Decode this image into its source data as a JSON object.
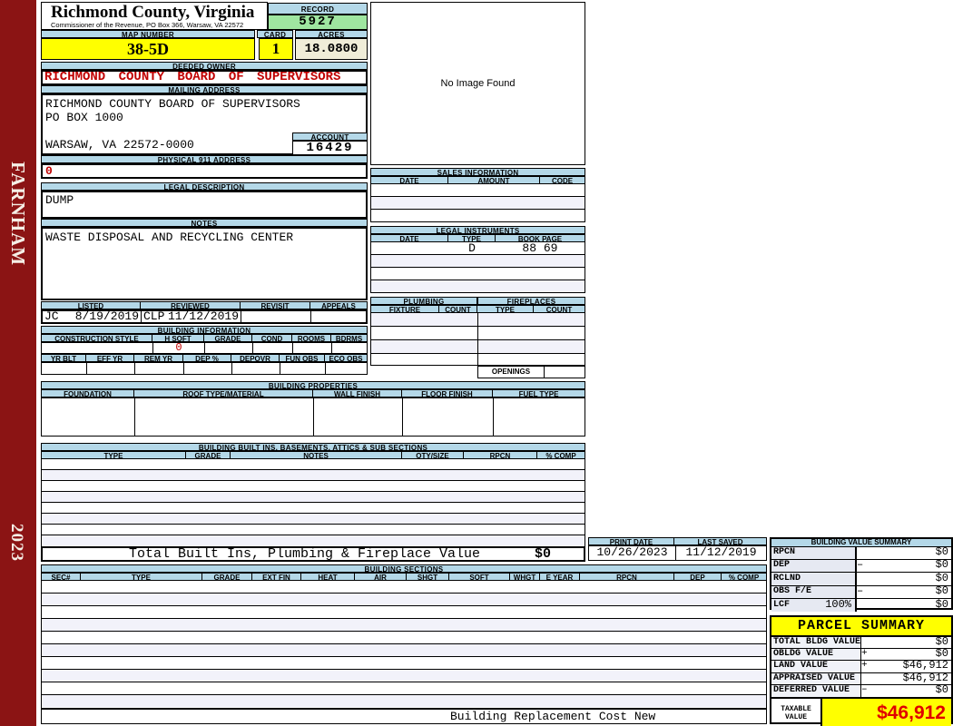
{
  "sidebar": {
    "district": "FARNHAM",
    "year": "2023"
  },
  "header": {
    "county": "Richmond County, Virginia",
    "subtitle": "Commissioner of the Revenue, PO Box 366, Warsaw, VA 22572",
    "record_label": "RECORD",
    "record": "5927",
    "map_number_label": "MAP NUMBER",
    "map_number": "38-5D",
    "card_label": "CARD",
    "card": "1",
    "acres_label": "ACRES",
    "acres": "18.0800"
  },
  "owner": {
    "deeded_owner_label": "DEEDED OWNER",
    "deeded_owner": "RICHMOND COUNTY BOARD OF SUPERVISORS",
    "mailing_address_label": "MAILING ADDRESS",
    "mailing_line1": "RICHMOND COUNTY BOARD OF SUPERVISORS",
    "mailing_line2": "PO BOX  1000",
    "mailing_line3": "WARSAW, VA 22572-0000",
    "account_label": "ACCOUNT",
    "account": "16429",
    "physical_911_label": "PHYSICAL 911 ADDRESS",
    "physical_911": "0",
    "legal_description_label": "LEGAL DESCRIPTION",
    "legal_description": "DUMP",
    "notes_label": "NOTES",
    "notes": "WASTE DISPOSAL AND RECYCLING CENTER"
  },
  "photo": {
    "no_image_text": "No Image Found"
  },
  "review": {
    "headers": [
      "LISTED",
      "REVIEWED",
      "REVISIT",
      "APPEALS"
    ],
    "listed_by": "JC",
    "listed_date": "8/19/2019",
    "reviewed_by": "CLP",
    "reviewed_date": "11/12/2019"
  },
  "building_information": {
    "title": "BUILDING INFORMATION",
    "row1_headers": [
      "CONSTRUCTION STYLE",
      "H SQFT",
      "GRADE",
      "COND",
      "ROOMS",
      "BDRMS"
    ],
    "h_sqft": "0",
    "row2_headers": [
      "YR BLT",
      "EFF YR",
      "REM YR",
      "DEP %",
      "DEPOVR",
      "FUN OBS",
      "ECO OBS"
    ]
  },
  "building_properties": {
    "title": "BUILDING PROPERTIES",
    "headers": [
      "FOUNDATION",
      "ROOF TYPE/MATERIAL",
      "WALL FINISH",
      "FLOOR FINISH",
      "FUEL TYPE"
    ]
  },
  "sales_information": {
    "title": "SALES INFORMATION",
    "headers": [
      "DATE",
      "AMOUNT",
      "CODE"
    ]
  },
  "legal_instruments": {
    "title": "LEGAL INSTRUMENTS",
    "headers": [
      "DATE",
      "TYPE",
      "BOOK PAGE"
    ],
    "row1": {
      "date": "",
      "type": "D",
      "book_page": "88 69"
    }
  },
  "plumbing": {
    "title": "PLUMBING",
    "headers": [
      "FIXTURE",
      "COUNT"
    ]
  },
  "fireplaces": {
    "title": "FIREPLACES",
    "headers": [
      "TYPE",
      "COUNT"
    ],
    "openings_label": "OPENINGS"
  },
  "built_ins": {
    "title": "BUILDING BUILT INS, BASEMENTS, ATTICS & SUB SECTIONS",
    "headers": [
      "TYPE",
      "GRADE",
      "NOTES",
      "QTY/SIZE",
      "RPCN",
      "% COMP"
    ],
    "total_label": "Total Built Ins, Plumbing & Fireplace Value",
    "total_value": "$0"
  },
  "print_info": {
    "print_date_label": "PRINT DATE",
    "print_date": "10/26/2023",
    "last_saved_label": "LAST SAVED",
    "last_saved": "11/12/2019"
  },
  "building_value_summary": {
    "title": "BUILDING VALUE SUMMARY",
    "rows": [
      {
        "label": "RPCN",
        "pct": "",
        "op": "",
        "value": "$0"
      },
      {
        "label": "DEP",
        "pct": "",
        "op": "–",
        "value": "$0"
      },
      {
        "label": "RCLND",
        "pct": "",
        "op": "",
        "value": "$0"
      },
      {
        "label": "OBS F/E",
        "pct": "",
        "op": "–",
        "value": "$0"
      },
      {
        "label": "LCF",
        "pct": "100%",
        "op": "",
        "value": "$0"
      }
    ]
  },
  "building_sections": {
    "title": "BUILDING SECTIONS",
    "headers": [
      "SEC#",
      "TYPE",
      "GRADE",
      "EXT FIN",
      "HEAT",
      "AIR",
      "SHGT",
      "SQFT",
      "WHGT",
      "E YEAR",
      "RPCN",
      "DEP",
      "% COMP"
    ],
    "footer_text": "Building Replacement Cost New"
  },
  "parcel_summary": {
    "title": "PARCEL SUMMARY",
    "rows": [
      {
        "label": "TOTAL BLDG VALUE",
        "op": "",
        "value": "$0"
      },
      {
        "label": "OBLDG VALUE",
        "op": "+",
        "value": "$0"
      },
      {
        "label": "LAND VALUE",
        "op": "+",
        "value": "$46,912"
      },
      {
        "label": "APPRAISED VALUE",
        "op": "",
        "value": "$46,912"
      },
      {
        "label": "DEFERRED VALUE",
        "op": "–",
        "value": "$0"
      }
    ],
    "taxable_label": "TAXABLE VALUE",
    "taxable_value": "$46,912"
  }
}
